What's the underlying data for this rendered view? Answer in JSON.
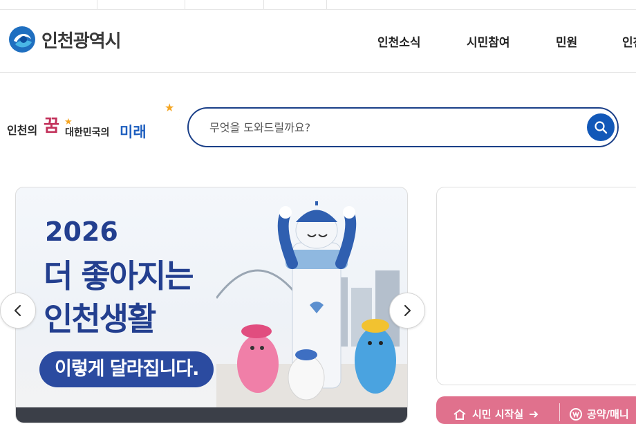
{
  "site": {
    "logo_text": "인천광역시"
  },
  "nav": {
    "items": [
      "인천소식",
      "시민참여",
      "민원",
      "인천"
    ]
  },
  "slogan": {
    "part1": "인천의",
    "dream": "꿈",
    "part2": "대한민국의",
    "future": "미래"
  },
  "search": {
    "placeholder": "무엇을 도와드릴까요?"
  },
  "banner": {
    "year": "2026",
    "line1": "더 좋아지는",
    "line2": "인천생활",
    "pill": "이렇게 달라집니다."
  },
  "quick": {
    "item1": "시민 시작실",
    "item2": "공약/매니"
  },
  "colors": {
    "brand_blue": "#1a3f88",
    "button_blue": "#1258b8",
    "banner_navy": "#233f8f",
    "pink": "#e0718d"
  },
  "icons": [
    "logo-mark-icon",
    "search-icon",
    "chevron-left-icon",
    "chevron-right-icon",
    "home-icon",
    "arrow-right-icon",
    "won-coin-icon"
  ]
}
